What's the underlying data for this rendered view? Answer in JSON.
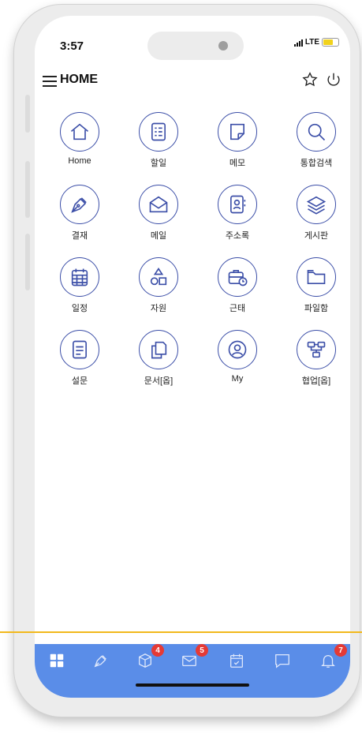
{
  "status_bar": {
    "time": "3:57",
    "network": "LTE"
  },
  "header": {
    "title": "HOME"
  },
  "grid_items": [
    {
      "label": "Home",
      "icon": "home-icon"
    },
    {
      "label": "할일",
      "icon": "checklist-icon"
    },
    {
      "label": "메모",
      "icon": "memo-icon"
    },
    {
      "label": "통합검색",
      "icon": "search-icon"
    },
    {
      "label": "결재",
      "icon": "pen-nib-icon"
    },
    {
      "label": "메일",
      "icon": "open-envelope-icon"
    },
    {
      "label": "주소록",
      "icon": "address-book-icon"
    },
    {
      "label": "게시판",
      "icon": "layers-icon"
    },
    {
      "label": "일정",
      "icon": "calendar-grid-icon"
    },
    {
      "label": "자원",
      "icon": "shapes-icon"
    },
    {
      "label": "근태",
      "icon": "briefcase-clock-icon"
    },
    {
      "label": "파일함",
      "icon": "folder-icon"
    },
    {
      "label": "설문",
      "icon": "survey-icon"
    },
    {
      "label": "문서[옵]",
      "icon": "documents-icon"
    },
    {
      "label": "My",
      "icon": "user-circle-icon"
    },
    {
      "label": "협업[옵]",
      "icon": "collaboration-icon"
    }
  ],
  "bottom_nav": [
    {
      "icon": "dashboard-icon",
      "badge": ""
    },
    {
      "icon": "pen-nib-icon",
      "badge": ""
    },
    {
      "icon": "box-icon",
      "badge": "4"
    },
    {
      "icon": "mail-icon",
      "badge": "5"
    },
    {
      "icon": "calendar-check-icon",
      "badge": ""
    },
    {
      "icon": "chat-icon",
      "badge": ""
    },
    {
      "icon": "bell-icon",
      "badge": "7"
    }
  ],
  "colors": {
    "accent": "#3c4fa8",
    "nav_bg": "#5a8de8",
    "badge": "#e53a35",
    "divider": "#f2b81c"
  }
}
